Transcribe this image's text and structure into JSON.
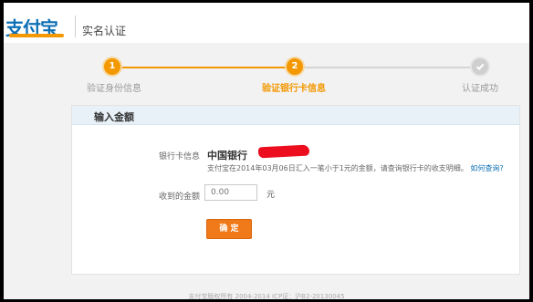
{
  "header": {
    "logo_text": "支付宝",
    "page_title": "实名认证"
  },
  "stepper": {
    "steps": [
      {
        "number": "1",
        "label": "验证身份信息",
        "state": "done"
      },
      {
        "number": "2",
        "label": "验证银行卡信息",
        "state": "current"
      },
      {
        "number": "",
        "label": "认证成功",
        "state": "pending"
      }
    ],
    "colors": {
      "active": "#f39800",
      "inactive": "#cfcfcf"
    }
  },
  "card": {
    "title": "输入金额",
    "bank_info_label": "银行卡信息",
    "bank_name": "中国银行",
    "hint_text": "支付宝在2014年03月06日汇入一笔小于1元的金额，请查询银行卡的收支明细。",
    "hint_link": "如何查询?",
    "amount_label": "收到的金额",
    "amount_placeholder": "0.00",
    "unit": "元",
    "confirm_label": "确 定"
  },
  "footer": {
    "text": "支付宝版权所有 2004-2014 ICP证：沪B2-20130045"
  }
}
